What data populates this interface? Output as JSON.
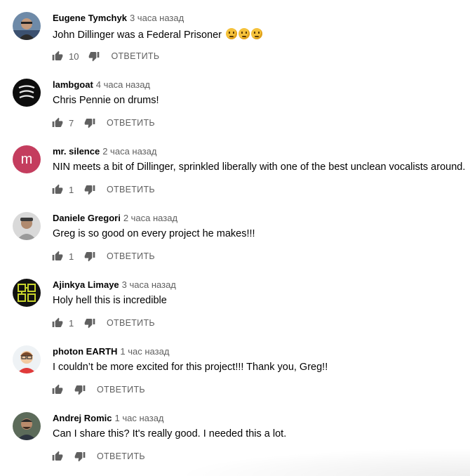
{
  "comments": [
    {
      "author": "Eugene Tymchyk",
      "time": "3 часа назад",
      "text": "John Dillinger was a Federal Prisoner",
      "emojis": [
        "thinking-face",
        "thinking-face",
        "thinking-face"
      ],
      "likes": "10",
      "reply": "ОТВЕТИТЬ",
      "avatar_icon": "person-photo-avatar"
    },
    {
      "author": "lambgoat",
      "time": "4 часа назад",
      "text": "Chris Pennie on drums!",
      "likes": "7",
      "reply": "ОТВЕТИТЬ",
      "avatar_icon": "lambgoat-logo-avatar"
    },
    {
      "author": "mr. silence",
      "time": "2 часа назад",
      "text": "NIN meets a bit of Dillinger, sprinkled liberally with one of the best unclean vocalists around.",
      "likes": "1",
      "reply": "ОТВЕТИТЬ",
      "avatar_letter": "m",
      "avatar_color": "#c43d5e"
    },
    {
      "author": "Daniele Gregori",
      "time": "2 часа назад",
      "text": "Greg is so good on every project he makes!!!",
      "likes": "1",
      "reply": "ОТВЕТИТЬ",
      "avatar_icon": "person-photo-avatar"
    },
    {
      "author": "Ajinkya Limaye",
      "time": "3 часа назад",
      "text": "Holy hell this is incredible",
      "likes": "1",
      "reply": "ОТВЕТИТЬ",
      "avatar_icon": "abcd-grid-avatar"
    },
    {
      "author": "photon EARTH",
      "time": "1 час назад",
      "text": "I couldn’t be more excited for this project!!! Thank you, Greg!!",
      "likes": "",
      "reply": "ОТВЕТИТЬ",
      "avatar_icon": "cartoon-person-avatar"
    },
    {
      "author": "Andrej Romic",
      "time": "1 час назад",
      "text": "Can I share this? It's really good. I needed this a lot.",
      "likes": "",
      "reply": "ОТВЕТИТЬ",
      "avatar_icon": "person-photo-avatar"
    }
  ],
  "colors": {
    "text": "#030303",
    "secondary": "#606060",
    "avatar_m": "#c43d5e",
    "abcd_green": "#c6d22b"
  }
}
